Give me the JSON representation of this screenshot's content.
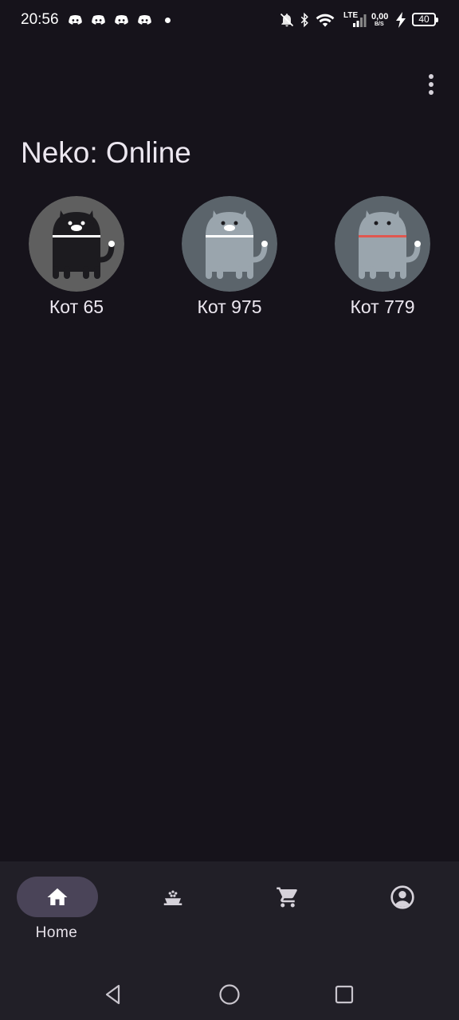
{
  "status_bar": {
    "time": "20:56",
    "network_type": "LTE",
    "speed_value": "0,00",
    "speed_unit": "B/S",
    "battery_level": "40",
    "notification_icons": [
      "discord-icon",
      "discord-icon",
      "discord-icon",
      "discord-icon"
    ]
  },
  "header": {
    "title": "Neko: Online",
    "menu_icon": "more-vert-icon"
  },
  "cats": [
    {
      "name": "Кот 65",
      "body_color": "#1c1b1f",
      "bg_color": "#5f5f5f",
      "collar_color": "#ffffff"
    },
    {
      "name": "Кот 975",
      "body_color": "#9aa5ad",
      "bg_color": "#5b646b",
      "collar_color": "#ffffff"
    },
    {
      "name": "Кот 779",
      "body_color": "#9aa5ad",
      "bg_color": "#5b646b",
      "collar_color": "#e0574f"
    }
  ],
  "bottom_nav": {
    "items": [
      {
        "label": "Home",
        "icon": "home-icon",
        "active": true
      },
      {
        "label": "",
        "icon": "food-bowl-icon",
        "active": false
      },
      {
        "label": "",
        "icon": "cart-icon",
        "active": false
      },
      {
        "label": "",
        "icon": "account-circle-icon",
        "active": false
      }
    ]
  },
  "system_nav": [
    "back-icon",
    "home-circle-icon",
    "recents-icon"
  ],
  "colors": {
    "background": "#16131b",
    "nav_background": "#211f27",
    "active_pill": "#4a4458"
  }
}
